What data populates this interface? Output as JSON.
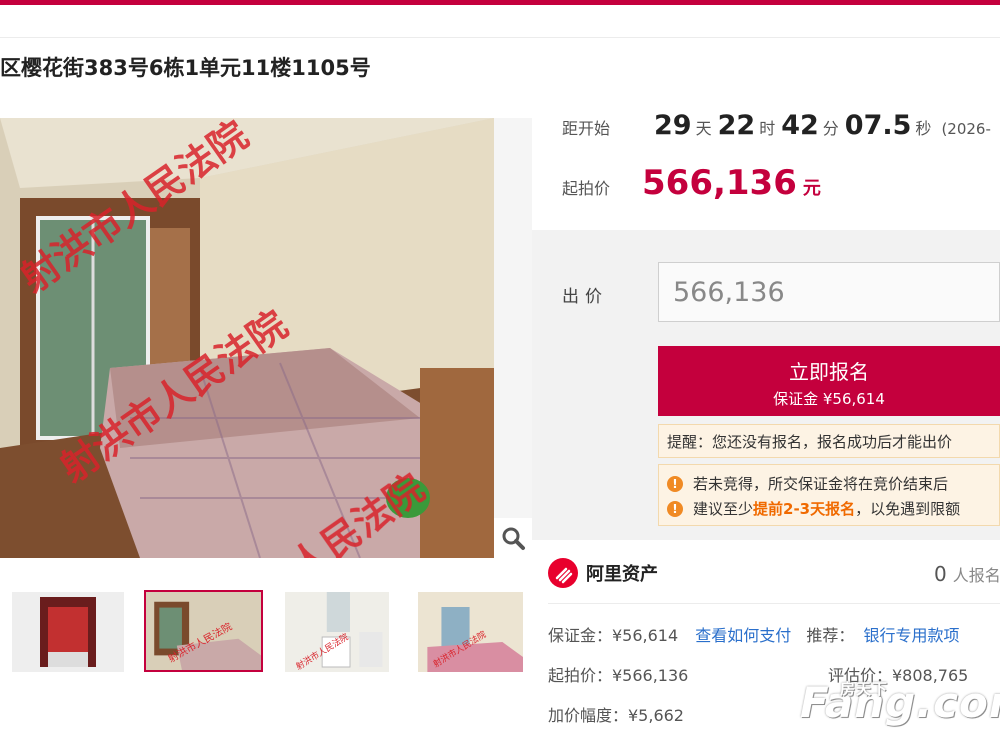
{
  "page": {
    "title": "区樱花街383号6栋1单元11楼1105号"
  },
  "countdown": {
    "label": "距开始",
    "days": "29",
    "days_unit": "天",
    "hours": "22",
    "hours_unit": "时",
    "minutes": "42",
    "minutes_unit": "分",
    "seconds": "07.5",
    "seconds_unit": "秒",
    "date": "(2026-"
  },
  "start_price": {
    "label": "起拍价",
    "value": "566,136",
    "unit": "元"
  },
  "bid": {
    "label": "出价",
    "input_value": "566,136",
    "button_main": "立即报名",
    "button_sub": "保证金 ¥56,614",
    "notice1": "提醒：您还没有报名，报名成功后才能出价",
    "notice2_line1": "若未竞得，所交保证金将在竞价结束后",
    "notice2_line2_pre": "建议至少",
    "notice2_line2_highlight": "提前2-3天报名",
    "notice2_line2_post": "，以免遇到限额"
  },
  "platform": {
    "name": "阿里资产",
    "signup_count": "0",
    "signup_label": "人报名"
  },
  "info": {
    "deposit": "保证金：¥56,614",
    "how_to_pay": "查看如何支付",
    "recommend_label": "推荐：",
    "recommend_link": "银行专用款项",
    "start_price": "起拍价：¥566,136",
    "appraisal": "评估价：¥808,765",
    "increment": "加价幅度：¥5,662"
  },
  "image": {
    "watermark_text": "射洪市人民法院",
    "site_watermark": "Fang.com",
    "site_watermark_cn": "房天下"
  },
  "colors": {
    "brand": "#c4003d",
    "link": "#2a6fcb",
    "highlight": "#f06a00"
  }
}
